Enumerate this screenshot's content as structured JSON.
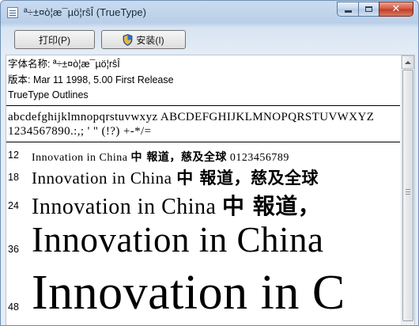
{
  "window": {
    "title": "ª÷±¤ò¦æ¯µö¦rŝÎ (TrueType)",
    "minimize_icon": "minimize-icon",
    "maximize_icon": "maximize-icon",
    "close_icon": "close-icon",
    "close_glyph": "✕"
  },
  "toolbar": {
    "print_label": "打印(P)",
    "install_label": "安装(I)",
    "install_icon": "shield-icon"
  },
  "info": {
    "font_name_line": "字体名称: ª÷±¤ò¦æ¯µö¦rŝÎ",
    "version_line": "版本: Mar 11 1998, 5.00 First Release",
    "type_line": "TrueType Outlines"
  },
  "charset": {
    "line1": "abcdefghijklmnopqrstuvwxyz ABCDEFGHIJKLMNOPQRSTUVWXYZ",
    "line2": "1234567890.:,; ' \" (!?) +-*/="
  },
  "samples": [
    {
      "size": "12",
      "latin": "Innovation in China",
      "cjk": "中 報道，慈及全球",
      "digits": "0123456789"
    },
    {
      "size": "18",
      "latin": "Innovation in China",
      "cjk": "中 報道，慈及全球",
      "digits": ""
    },
    {
      "size": "24",
      "latin": "Innovation in China",
      "cjk": "中 報道，",
      "digits": ""
    },
    {
      "size": "36",
      "latin": "Innovation in China",
      "cjk": "",
      "digits": ""
    },
    {
      "size": "48",
      "latin": "Innovation in C",
      "cjk": "",
      "digits": ""
    }
  ]
}
